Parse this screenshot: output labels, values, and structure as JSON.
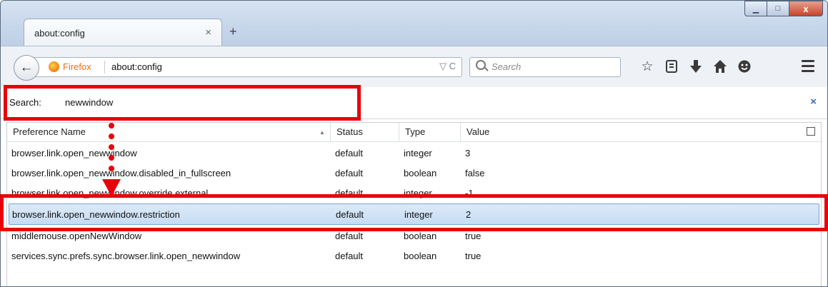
{
  "tab": {
    "title": "about:config",
    "close": "×",
    "new_tab": "+"
  },
  "window_controls": {
    "minimize": "▁",
    "maximize": "□",
    "close": "x"
  },
  "nav": {
    "back": "←",
    "identity": "Firefox",
    "url": "about:config",
    "url_icons": "▽ C",
    "search_placeholder": "Search"
  },
  "toolbar_icons": [
    "star-icon",
    "reading-list-icon",
    "download-icon",
    "home-icon",
    "hello-icon",
    "menu-icon"
  ],
  "filter": {
    "label": "Search:",
    "value": "newwindow",
    "clear": "×"
  },
  "columns": {
    "name": "Preference Name",
    "status": "Status",
    "type": "Type",
    "value": "Value"
  },
  "rows": [
    {
      "name": "browser.link.open_newwindow",
      "status": "default",
      "type": "integer",
      "value": "3"
    },
    {
      "name": "browser.link.open_newwindow.disabled_in_fullscreen",
      "status": "default",
      "type": "boolean",
      "value": "false"
    },
    {
      "name": "browser.link.open_newwindow.override.external",
      "status": "default",
      "type": "integer",
      "value": "-1"
    },
    {
      "name": "browser.link.open_newwindow.restriction",
      "status": "default",
      "type": "integer",
      "value": "2"
    },
    {
      "name": "middlemouse.openNewWindow",
      "status": "default",
      "type": "boolean",
      "value": "true"
    },
    {
      "name": "services.sync.prefs.sync.browser.link.open_newwindow",
      "status": "default",
      "type": "boolean",
      "value": "true"
    }
  ],
  "selected_row_index": 3,
  "annotation_color": "#e8000b"
}
